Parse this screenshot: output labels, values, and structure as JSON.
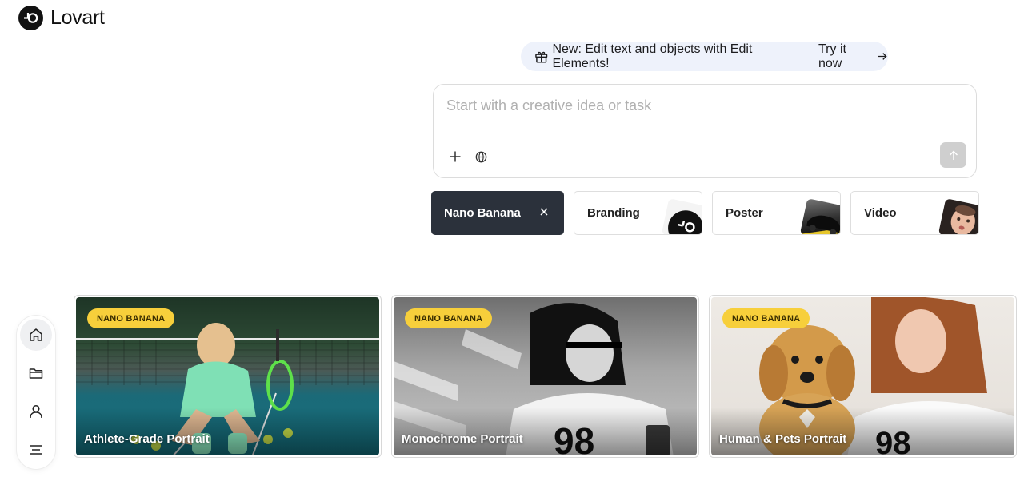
{
  "app": {
    "name": "Lovart"
  },
  "announcement": {
    "text": "New: Edit text and objects with Edit Elements!",
    "cta": "Try it now"
  },
  "prompt": {
    "placeholder": "Start with a creative idea or task",
    "value": ""
  },
  "chips": [
    {
      "label": "Nano Banana",
      "selected": true
    },
    {
      "label": "Branding",
      "selected": false
    },
    {
      "label": "Poster",
      "selected": false
    },
    {
      "label": "Video",
      "selected": false
    }
  ],
  "sidebar": {
    "items": [
      {
        "icon": "home-icon",
        "active": true
      },
      {
        "icon": "folder-icon",
        "active": false
      },
      {
        "icon": "user-icon",
        "active": false
      },
      {
        "icon": "menu-icon",
        "active": false
      }
    ]
  },
  "cards": [
    {
      "badge": "NANO BANANA",
      "title": "Athlete-Grade Portrait"
    },
    {
      "badge": "NANO BANANA",
      "title": "Monochrome Portrait"
    },
    {
      "badge": "NANO BANANA",
      "title": "Human & Pets Portrait"
    }
  ],
  "colors": {
    "accent_dark": "#2b313b",
    "badge_yellow": "#f7cf3b",
    "announce_bg": "#eef2fb"
  }
}
